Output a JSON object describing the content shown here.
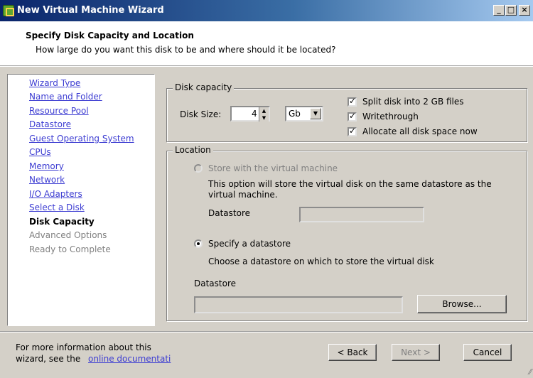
{
  "window": {
    "title": "New Virtual Machine Wizard",
    "controls": {
      "minimize": "_",
      "maximize": "□",
      "close": "×"
    }
  },
  "header": {
    "title": "Specify Disk Capacity and Location",
    "subtitle": "How large do you want this disk to be and where should it be located?"
  },
  "nav": {
    "items": [
      {
        "label": "Wizard Type",
        "state": "link"
      },
      {
        "label": "Name and Folder",
        "state": "link"
      },
      {
        "label": "Resource Pool",
        "state": "link"
      },
      {
        "label": "Datastore",
        "state": "link"
      },
      {
        "label": "Guest Operating System",
        "state": "link"
      },
      {
        "label": "CPUs",
        "state": "link"
      },
      {
        "label": "Memory",
        "state": "link"
      },
      {
        "label": "Network",
        "state": "link"
      },
      {
        "label": "I/O Adapters",
        "state": "link"
      },
      {
        "label": "Select a Disk",
        "state": "link"
      },
      {
        "label": "Disk Capacity",
        "state": "current"
      },
      {
        "label": "Advanced Options",
        "state": "disabled"
      },
      {
        "label": "Ready to Complete",
        "state": "disabled"
      }
    ]
  },
  "disk_capacity": {
    "legend": "Disk capacity",
    "size_label": "Disk Size:",
    "size_value": "4",
    "unit": "Gb",
    "split_label": "Split disk into 2 GB files",
    "split_checked": true,
    "writethrough_label": "Writethrough",
    "writethrough_checked": true,
    "allocate_label": "Allocate all disk space now",
    "allocate_checked": true
  },
  "location": {
    "legend": "Location",
    "option1_label": "Store with the virtual machine",
    "option1_desc": "This option will store the virtual disk on the same datastore as the virtual machine.",
    "option1_datastore_label": "Datastore",
    "option2_label": "Specify a datastore",
    "option2_desc": "Choose a datastore on which to store the virtual disk",
    "datastore_label": "Datastore",
    "datastore_value": "",
    "browse_label": "Browse..."
  },
  "footer": {
    "info_line1": "For more information about this",
    "info_line2": "wizard, see the",
    "info_link": "online documentati",
    "back_label": "< Back",
    "next_label": "Next >",
    "cancel_label": "Cancel"
  }
}
